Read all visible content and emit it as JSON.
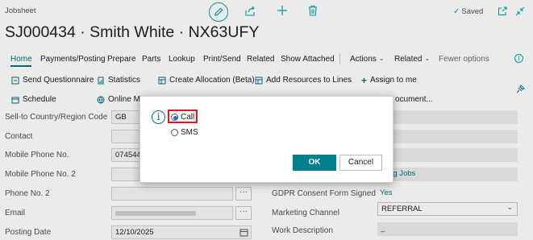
{
  "header": {
    "page_type": "Jobsheet",
    "title": "SJ000434 · Smith White · NX63UFY",
    "saved_label": "Saved"
  },
  "tabs": [
    {
      "label": "Home",
      "active": true
    },
    {
      "label": "Payments/Posting"
    },
    {
      "label": "Prepare"
    },
    {
      "label": "Parts"
    },
    {
      "label": "Lookup"
    },
    {
      "label": "Print/Send"
    },
    {
      "label": "Related"
    },
    {
      "label": "Show Attached"
    },
    {
      "label": "Actions"
    },
    {
      "label": "Related"
    },
    {
      "label": "Fewer options"
    }
  ],
  "actions": {
    "send_questionnaire": "Send Questionnaire",
    "statistics": "Statistics",
    "create_allocation": "Create Allocation (Beta)",
    "add_resources": "Add Resources to Lines",
    "assign_to_me": "Assign to me",
    "schedule": "Schedule",
    "online_ma": "Online Ma",
    "document": "ocument..."
  },
  "fields": {
    "country_label": "Sell-to Country/Region Code",
    "country_value": "GB",
    "contact_label": "Contact",
    "contact_value": "",
    "mobile_label": "Mobile Phone No.",
    "mobile_value": "0745444",
    "mobile2_label": "Mobile Phone No. 2",
    "mobile2_value": "",
    "phone2_label": "Phone No. 2",
    "phone2_value": "",
    "email_label": "Email",
    "posting_label": "Posting Date",
    "posting_value": "12/10/2025"
  },
  "right_fields": {
    "upcoming_jobs": "ming Jobs",
    "gdpr_label": "GDPR Consent Form Signed",
    "gdpr_value": "Yes",
    "marketing_label": "Marketing Channel",
    "marketing_value": "REFERRAL",
    "work_label": "Work Description",
    "work_value": "_"
  },
  "dialog": {
    "option_call": "Call",
    "option_sms": "SMS",
    "ok_label": "OK",
    "cancel_label": "Cancel",
    "selected": "Call"
  },
  "colors": {
    "accent": "#00a2ad",
    "ok_button": "#00808a",
    "highlight": "#e0191c"
  }
}
